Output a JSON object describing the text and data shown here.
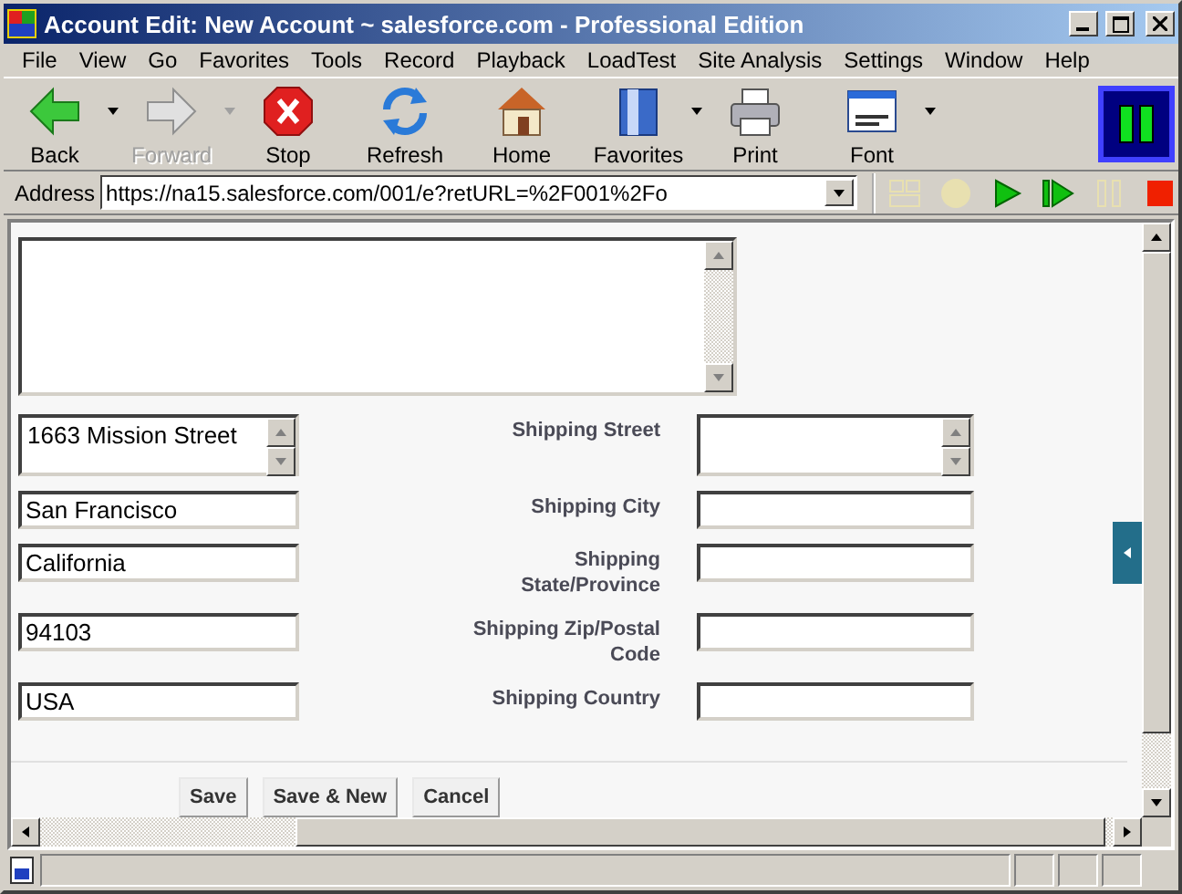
{
  "window": {
    "title": "Account Edit: New Account ~ salesforce.com - Professional Edition"
  },
  "menu": [
    "File",
    "View",
    "Go",
    "Favorites",
    "Tools",
    "Record",
    "Playback",
    "LoadTest",
    "Site Analysis",
    "Settings",
    "Window",
    "Help"
  ],
  "toolbar": [
    {
      "label": "Back",
      "kind": "back",
      "disabled": false,
      "dropdown": true
    },
    {
      "label": "Forward",
      "kind": "forward",
      "disabled": true,
      "dropdown": true
    },
    {
      "label": "Stop",
      "kind": "stop",
      "disabled": false,
      "dropdown": false
    },
    {
      "label": "Refresh",
      "kind": "refresh",
      "disabled": false,
      "dropdown": false
    },
    {
      "label": "Home",
      "kind": "home",
      "disabled": false,
      "dropdown": false
    },
    {
      "label": "Favorites",
      "kind": "favorites",
      "disabled": false,
      "dropdown": true
    },
    {
      "label": "Print",
      "kind": "print",
      "disabled": false,
      "dropdown": false
    },
    {
      "label": "Font",
      "kind": "font",
      "disabled": false,
      "dropdown": true
    }
  ],
  "address": {
    "label": "Address",
    "value": "https://na15.salesforce.com/001/e?retURL=%2F001%2Fo"
  },
  "playback": [
    {
      "kind": "grid",
      "disabled": true
    },
    {
      "kind": "record",
      "disabled": true
    },
    {
      "kind": "play",
      "disabled": false
    },
    {
      "kind": "step",
      "disabled": false
    },
    {
      "kind": "pause",
      "disabled": true
    },
    {
      "kind": "stop",
      "disabled": false
    }
  ],
  "form": {
    "rows": [
      {
        "kind": "multiline",
        "value": "1663 Mission Street",
        "label": "Shipping Street",
        "shipping_value": ""
      },
      {
        "kind": "line",
        "value": "San Francisco",
        "label": "Shipping City",
        "shipping_value": ""
      },
      {
        "kind": "line",
        "value": "California",
        "label": "Shipping State/Province",
        "shipping_value": ""
      },
      {
        "kind": "line",
        "value": "94103",
        "label": "Shipping Zip/Postal Code",
        "shipping_value": ""
      },
      {
        "kind": "line",
        "value": "USA",
        "label": "Shipping Country",
        "shipping_value": ""
      }
    ],
    "buttons": [
      "Save",
      "Save & New",
      "Cancel"
    ]
  }
}
